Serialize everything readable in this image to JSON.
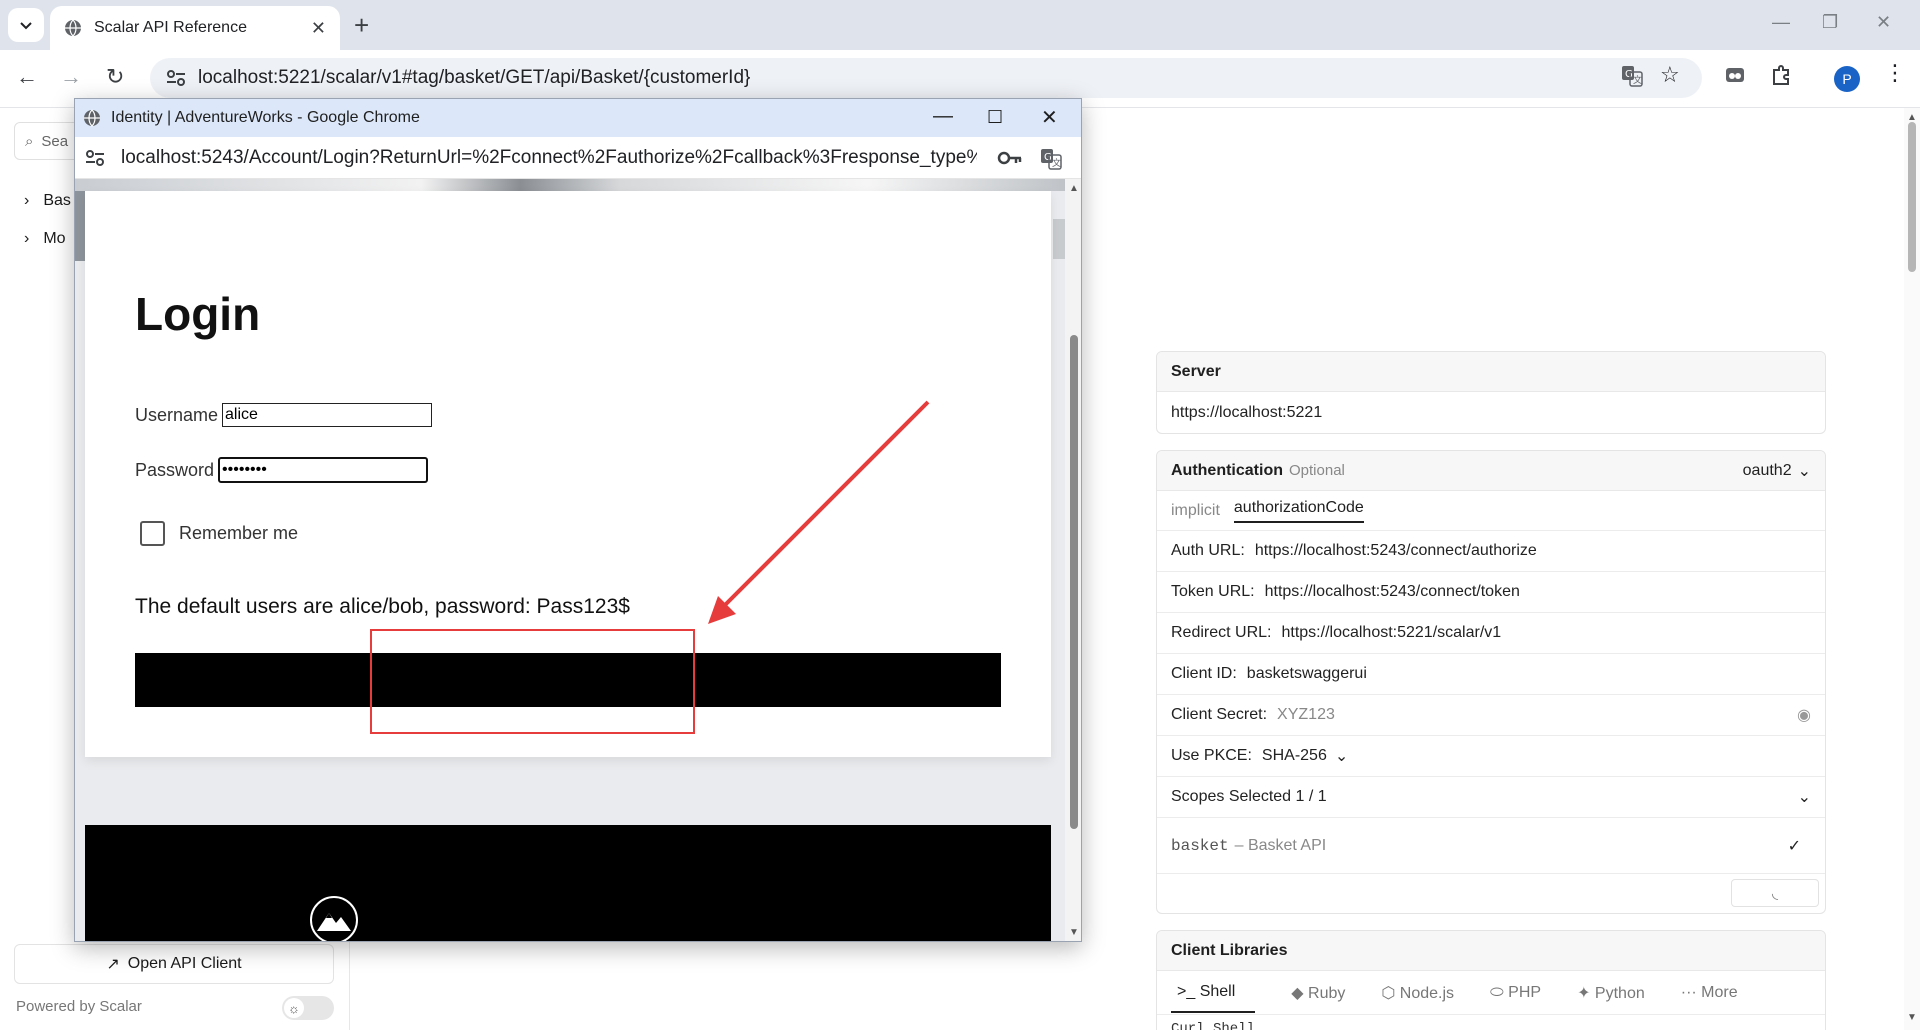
{
  "browser": {
    "tab_title": "Scalar API Reference",
    "url": "localhost:5221/scalar/v1#tag/basket/GET/api/Basket/{customerId}",
    "profile_initial": "P"
  },
  "sidebar": {
    "search_placeholder": "Sea",
    "items": [
      {
        "label": "Bas"
      },
      {
        "label": "Mo"
      }
    ],
    "open_client_label": "Open API Client",
    "powered_by": "Powered by Scalar"
  },
  "server": {
    "title": "Server",
    "url": "https://localhost:5221"
  },
  "auth": {
    "title": "Authentication",
    "optional": "Optional",
    "scheme": "oauth2",
    "flows": [
      "implicit",
      "authorizationCode"
    ],
    "auth_url_label": "Auth URL:",
    "auth_url": "https://localhost:5243/connect/authorize",
    "token_url_label": "Token URL:",
    "token_url": "https://localhost:5243/connect/token",
    "redirect_url_label": "Redirect URL:",
    "redirect_url": "https://localhost:5221/scalar/v1",
    "client_id_label": "Client ID:",
    "client_id": "basketswaggerui",
    "client_secret_label": "Client Secret:",
    "client_secret": "XYZ123",
    "pkce_label": "Use PKCE:",
    "pkce_value": "SHA-256",
    "scopes_label": "Scopes Selected 1 / 1",
    "scope_name": "basket",
    "scope_desc": "– Basket API"
  },
  "client_libraries": {
    "title": "Client Libraries",
    "tabs": [
      "Shell",
      "Ruby",
      "Node.js",
      "PHP",
      "Python",
      "More"
    ],
    "code_peek": "Curl Shell"
  },
  "popup": {
    "window_title": "Identity | AdventureWorks - Google Chrome",
    "url": "localhost:5243/Account/Login?ReturnUrl=%2Fconnect%2Fauthorize%2Fcallback%3Fresponse_type%...",
    "login_title": "Login",
    "username_label": "Username",
    "username_value": "alice",
    "password_label": "Password",
    "password_value": "••••••••",
    "remember_label": "Remember me",
    "hint": "The default users are alice/bob, password: Pass123$"
  },
  "colors": {
    "annotation": "#e73c3c",
    "popup_titlebar": "#dce8fa",
    "login_button": "#000000"
  }
}
